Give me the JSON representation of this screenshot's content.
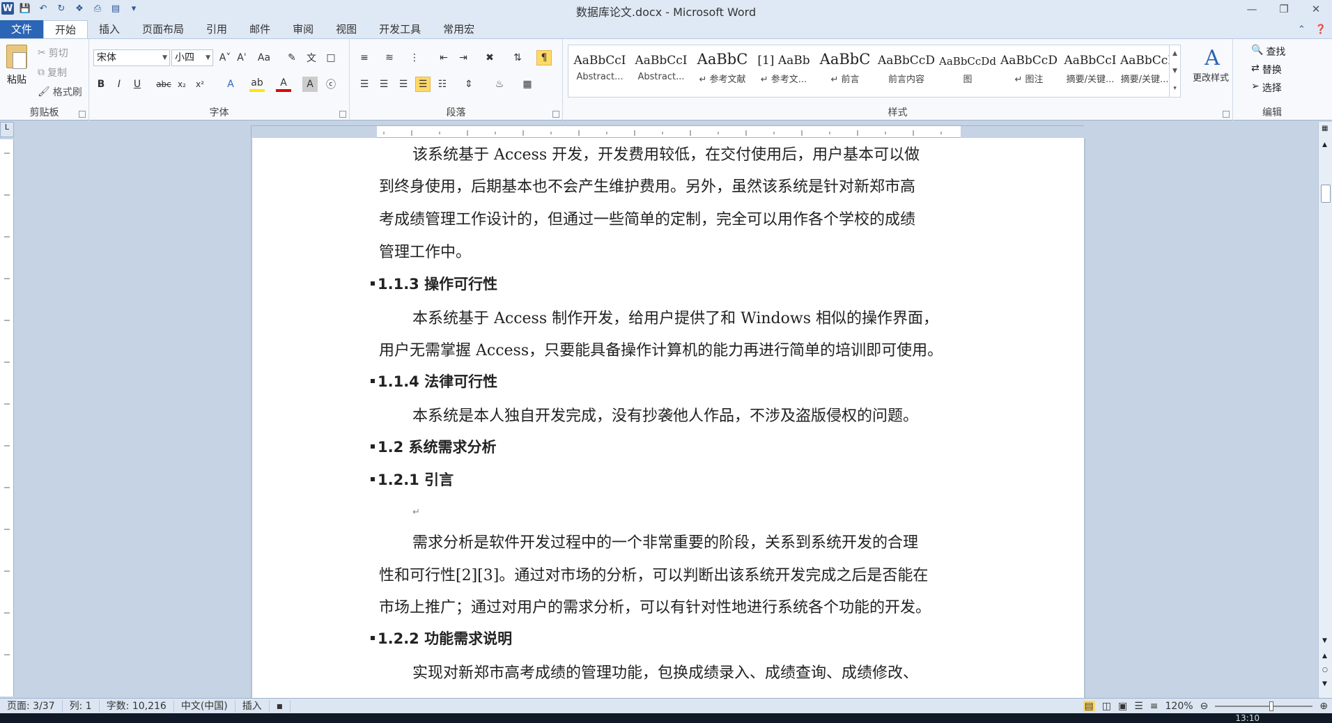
{
  "window": {
    "title": "数据库论文.docx - Microsoft Word"
  },
  "tabs": [
    "文件",
    "开始",
    "插入",
    "页面布局",
    "引用",
    "邮件",
    "审阅",
    "视图",
    "开发工具",
    "常用宏"
  ],
  "clipboard": {
    "paste": "粘贴",
    "cut": "剪切",
    "copy": "复制",
    "format_painter": "格式刷",
    "label": "剪贴板"
  },
  "font": {
    "name": "宋体",
    "size": "小四",
    "label": "字体"
  },
  "paragraph": {
    "label": "段落"
  },
  "styles": {
    "label": "样式",
    "items": [
      {
        "sample": "AaBbCcI",
        "name": "Abstract..."
      },
      {
        "sample": "AaBbCcI",
        "name": "Abstract..."
      },
      {
        "sample": "AaBbC",
        "name": "↵ 参考文献"
      },
      {
        "sample": "[1] AaBb",
        "name": "↵ 参考文..."
      },
      {
        "sample": "AaBbC",
        "name": "↵ 前言"
      },
      {
        "sample": "AaBbCcD",
        "name": "前言内容"
      },
      {
        "sample": "AaBbCcDd",
        "name": "图"
      },
      {
        "sample": "AaBbCcD",
        "name": "↵ 图注"
      },
      {
        "sample": "AaBbCcI",
        "name": "摘要/关键..."
      },
      {
        "sample": "AaBbCcD",
        "name": "摘要/关键..."
      }
    ],
    "change": "更改样式"
  },
  "editing": {
    "find": "查找",
    "replace": "替换",
    "select": "选择",
    "label": "编辑"
  },
  "document": {
    "lines": [
      "该系统基于 Access 开发，开发费用较低，在交付使用后，用户基本可以做",
      "到终身使用，后期基本也不会产生维护费用。另外，虽然该系统是针对新郑市高",
      "考成绩管理工作设计的，但通过一些简单的定制，完全可以用作各个学校的成绩",
      "管理工作中。",
      "1.1.3 操作可行性",
      "本系统基于 Access 制作开发，给用户提供了和 Windows 相似的操作界面，",
      "用户无需掌握 Access，只要能具备操作计算机的能力再进行简单的培训即可使用。",
      "1.1.4 法律可行性",
      "本系统是本人独自开发完成，没有抄袭他人作品，不涉及盗版侵权的问题。",
      "1.2 系统需求分析",
      "1.2.1 引言",
      "需求分析是软件开发过程中的一个非常重要的阶段，关系到系统开发的合理",
      "性和可行性[2][3]。通过对市场的分析，可以判断出该系统开发完成之后是否能在",
      "市场上推广；通过对用户的需求分析，可以有针对性地进行系统各个功能的开发。",
      "1.2.2 功能需求说明",
      "实现对新郑市高考成绩的管理功能，包换成绩录入、成绩查询、成绩修改、"
    ]
  },
  "status": {
    "page": "页面: 3/37",
    "col": "列: 1",
    "words": "字数: 10,216",
    "lang": "中文(中国)",
    "mode": "插入",
    "zoom": "120%"
  },
  "taskbar": {
    "clock": "13:10"
  },
  "colors": {
    "file_tab": "#2b65b5",
    "ribbon_bg": "#f7f9fc",
    "doc_bg": "#c5d3e5"
  }
}
